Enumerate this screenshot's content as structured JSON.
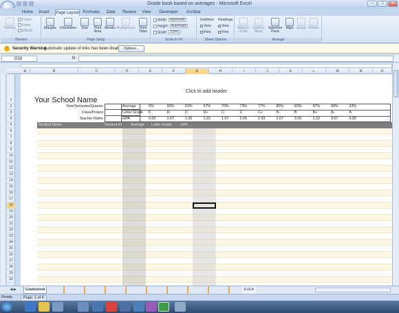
{
  "window": {
    "title": "Grade book based on averages - Microsoft Excel",
    "controls": [
      "–",
      "□",
      "✕"
    ]
  },
  "tabs": [
    "Home",
    "Insert",
    "Page Layout",
    "Formulas",
    "Data",
    "Review",
    "View",
    "Developer",
    "Acrobat"
  ],
  "active_tab": "Page Layout",
  "ribbon": {
    "themes": {
      "label": "Themes",
      "main": "Themes",
      "items": [
        "Colors",
        "Fonts",
        "Effects"
      ]
    },
    "page_setup": {
      "label": "Page Setup",
      "buttons": [
        "Margins",
        "Orientation",
        "Size",
        "Print Area",
        "Breaks",
        "Background",
        "Print Titles"
      ]
    },
    "scale_to_fit": {
      "label": "Scale to Fit",
      "width_label": "Width:",
      "width_value": "Automatic",
      "height_label": "Height:",
      "height_value": "Automatic",
      "scale_label": "Scale:",
      "scale_value": "100%"
    },
    "sheet_options": {
      "label": "Sheet Options",
      "gridlines": "Gridlines",
      "headings": "Headings",
      "view": "View",
      "print": "Print"
    },
    "arrange": {
      "label": "Arrange",
      "buttons": [
        "Bring to Front",
        "Send to Back",
        "Selection Pane",
        "Align",
        "Group",
        "Rotate"
      ]
    }
  },
  "security": {
    "label": "Security Warning",
    "message": "Automatic update of links has been disabled",
    "options_button": "Options..."
  },
  "formula_bar": {
    "name_box": "G18",
    "fx": "fx",
    "value": ""
  },
  "columns": [
    "A",
    "B",
    "C",
    "D",
    "E",
    "F",
    "G",
    "H",
    "I",
    "J",
    "K",
    "L",
    "M",
    "N",
    "O",
    "P"
  ],
  "selected_column": "G",
  "rows": [
    "1",
    "2",
    "3",
    "4",
    "5",
    "6",
    "7",
    "8",
    "9",
    "10",
    "11",
    "12",
    "13",
    "14",
    "15",
    "16",
    "17",
    "18",
    "19",
    "20",
    "21",
    "22",
    "23",
    "24",
    "25",
    "26",
    "27",
    "28",
    "29",
    "30",
    "31",
    "32",
    "33"
  ],
  "selected_row": "18",
  "page": {
    "header_hint": "Click to add header"
  },
  "sheet": {
    "school_name": "Your School Name",
    "info_labels": [
      "Year/Semester/Quarter",
      "Class/Project",
      "Teacher Name"
    ],
    "scale_labels": [
      "Average",
      "Letter Grade",
      "GPA"
    ],
    "averages": [
      "0%",
      "60%",
      "63%",
      "67%",
      "70%",
      "73%",
      "77%",
      "80%",
      "83%",
      "87%",
      "90%",
      "93%"
    ],
    "letter_grades": [
      "F",
      "D-",
      "D",
      "D+",
      "C-",
      "C",
      "C+",
      "B-",
      "B",
      "B+",
      "A-",
      "A"
    ],
    "gpas": [
      "0.00",
      "0.67",
      "1.00",
      "1.33",
      "1.67",
      "2.00",
      "2.33",
      "2.67",
      "3.00",
      "3.33",
      "3.67",
      "4.00"
    ],
    "table_headers": [
      "Student Name",
      "Student ID",
      "Average",
      "Letter Grade",
      "GPA"
    ]
  },
  "sheet_tabs": [
    "Gradebook",
    "EULA"
  ],
  "status": {
    "ready": "Ready",
    "page": "Page: 1 of 4"
  },
  "colors": {
    "accent": "#f8d68b",
    "header_row": "#7d7d7d",
    "band_yellow": "#fdf8e6"
  }
}
